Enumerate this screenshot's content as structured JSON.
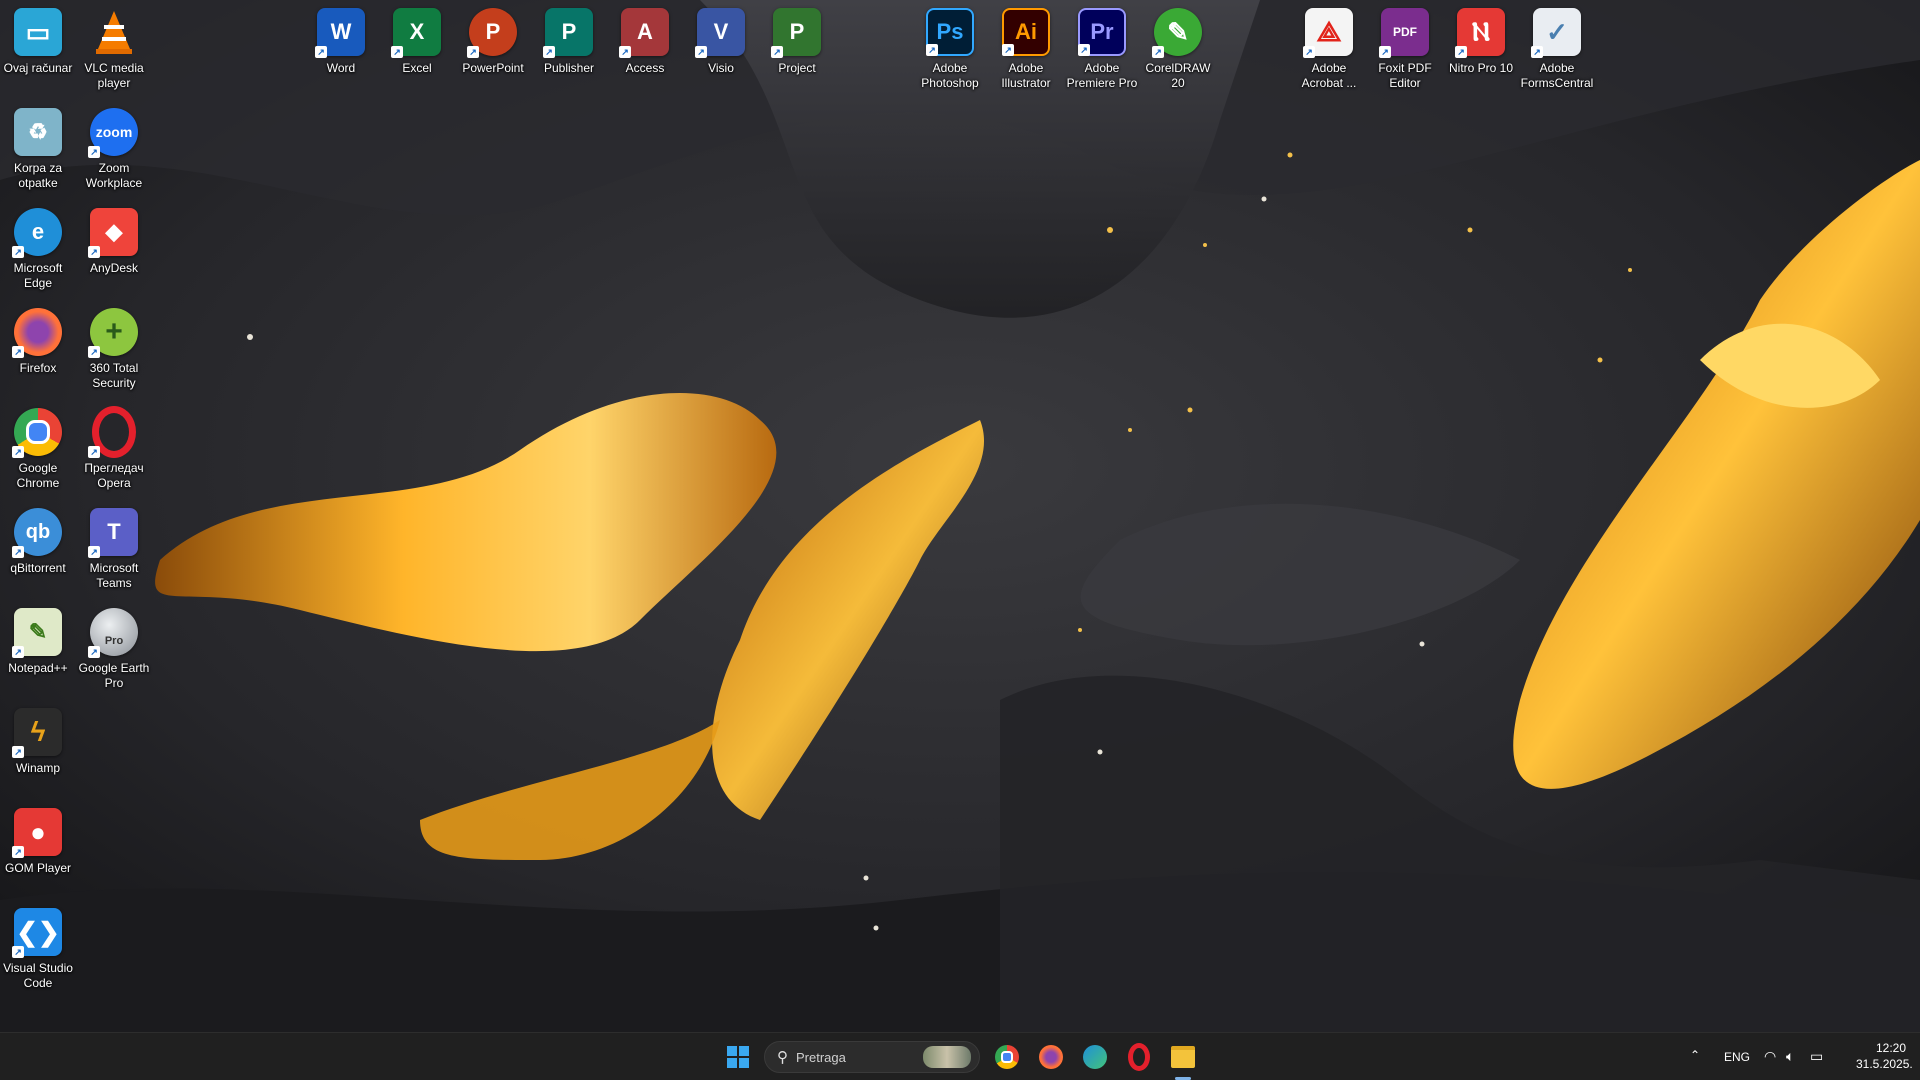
{
  "desktop": {
    "left_column_1": [
      {
        "label": "Ovaj računar",
        "icon": "monitor-icon",
        "color": "#2aa6d6"
      },
      {
        "label": "Korpa za otpatke",
        "icon": "recycle-bin-icon",
        "color": "#7fb4c9"
      },
      {
        "label": "Microsoft Edge",
        "icon": "edge-icon",
        "color": "#1f8fd8"
      },
      {
        "label": "Firefox",
        "icon": "firefox-icon",
        "color": "#ff7139"
      },
      {
        "label": "Google Chrome",
        "icon": "chrome-icon",
        "color": "#34a853"
      },
      {
        "label": "qBittorrent",
        "icon": "qbittorrent-icon",
        "color": "#3b8ed8"
      },
      {
        "label": "Notepad++",
        "icon": "notepadpp-icon",
        "color": "#8bc34a"
      },
      {
        "label": "Winamp",
        "icon": "winamp-icon",
        "color": "#e8a21a"
      },
      {
        "label": "GOM Player",
        "icon": "gom-player-icon",
        "color": "#e53935"
      },
      {
        "label": "Visual Studio Code",
        "icon": "vscode-icon",
        "color": "#1e88e5"
      }
    ],
    "left_column_2": [
      {
        "label": "VLC media player",
        "icon": "vlc-icon",
        "color": "#f57c00"
      },
      {
        "label": "Zoom Workplace",
        "icon": "zoom-icon",
        "color": "#1e6ff0",
        "text": "zoom"
      },
      {
        "label": "AnyDesk",
        "icon": "anydesk-icon",
        "color": "#ef443b"
      },
      {
        "label": "360 Total Security",
        "icon": "360-security-icon",
        "color": "#8dc63f"
      },
      {
        "label": "Прегледач Opera",
        "icon": "opera-icon",
        "color": "#e4202c"
      },
      {
        "label": "Microsoft Teams",
        "icon": "teams-icon",
        "color": "#5b5fc7",
        "text": "T"
      },
      {
        "label": "Google Earth Pro",
        "icon": "google-earth-icon",
        "color": "#8a8f96",
        "text": "Pro"
      }
    ],
    "top_row_office": [
      {
        "label": "Word",
        "icon": "word-icon",
        "color": "#185abd",
        "text": "W"
      },
      {
        "label": "Excel",
        "icon": "excel-icon",
        "color": "#107c41",
        "text": "X"
      },
      {
        "label": "PowerPoint",
        "icon": "powerpoint-icon",
        "color": "#c43e1c",
        "text": "P"
      },
      {
        "label": "Publisher",
        "icon": "publisher-icon",
        "color": "#077568",
        "text": "P"
      },
      {
        "label": "Access",
        "icon": "access-icon",
        "color": "#a4373a",
        "text": "A"
      },
      {
        "label": "Visio",
        "icon": "visio-icon",
        "color": "#3955a3",
        "text": "V"
      },
      {
        "label": "Project",
        "icon": "project-icon",
        "color": "#31752f",
        "text": "P"
      }
    ],
    "top_row_adobe": [
      {
        "label": "Adobe Photoshop",
        "icon": "photoshop-icon",
        "color": "#001e36",
        "fg": "#31a8ff",
        "text": "Ps"
      },
      {
        "label": "Adobe Illustrator",
        "icon": "illustrator-icon",
        "color": "#330000",
        "fg": "#ff9a00",
        "text": "Ai"
      },
      {
        "label": "Adobe Premiere Pro",
        "icon": "premiere-icon",
        "color": "#00005b",
        "fg": "#9999ff",
        "text": "Pr"
      },
      {
        "label": "CorelDRAW 20",
        "icon": "coreldraw-icon",
        "color": "#3aa935"
      }
    ],
    "top_row_pdf": [
      {
        "label": "Adobe Acrobat ...",
        "icon": "acrobat-icon",
        "color": "#f4f4f4",
        "fg": "#e2231a"
      },
      {
        "label": "Foxit PDF Editor",
        "icon": "foxit-icon",
        "color": "#7b2d8e",
        "text": "PDF"
      },
      {
        "label": "Nitro Pro 10",
        "icon": "nitro-icon",
        "color": "#e53935"
      },
      {
        "label": "Adobe FormsCentral",
        "icon": "formscentral-icon",
        "color": "#e9edf2",
        "fg": "#4a7fb0"
      }
    ]
  },
  "taskbar": {
    "search_placeholder": "Pretraga",
    "pinned": [
      {
        "name": "chrome-taskbar",
        "icon": "chrome-icon",
        "color": "#34a853"
      },
      {
        "name": "firefox-taskbar",
        "icon": "firefox-icon",
        "color": "#ff7139"
      },
      {
        "name": "edge-taskbar",
        "icon": "edge-icon",
        "color": "#1f8fd8"
      },
      {
        "name": "opera-taskbar",
        "icon": "opera-icon",
        "color": "#e4202c"
      },
      {
        "name": "file-explorer-taskbar",
        "icon": "folder-icon",
        "color": "#f3c33b"
      }
    ],
    "tray": {
      "language": "ENG",
      "time": "12:20",
      "date": "31.5.2025."
    }
  }
}
